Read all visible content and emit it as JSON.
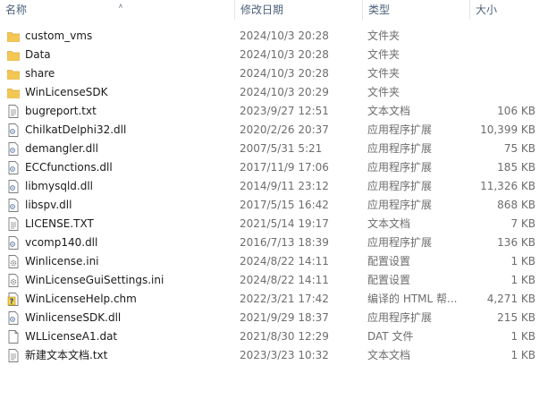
{
  "columns": {
    "name": "名称",
    "date": "修改日期",
    "type": "类型",
    "size": "大小"
  },
  "files": [
    {
      "name": "custom_vms",
      "date": "2024/10/3 20:28",
      "type": "文件夹",
      "size": "",
      "icon": "folder-icon"
    },
    {
      "name": "Data",
      "date": "2024/10/3 20:28",
      "type": "文件夹",
      "size": "",
      "icon": "folder-icon"
    },
    {
      "name": "share",
      "date": "2024/10/3 20:28",
      "type": "文件夹",
      "size": "",
      "icon": "folder-icon"
    },
    {
      "name": "WinLicenseSDK",
      "date": "2024/10/3 20:29",
      "type": "文件夹",
      "size": "",
      "icon": "folder-icon"
    },
    {
      "name": "bugreport.txt",
      "date": "2023/9/27 12:51",
      "type": "文本文档",
      "size": "106 KB",
      "icon": "text-file-icon"
    },
    {
      "name": "ChilkatDelphi32.dll",
      "date": "2020/2/26 20:37",
      "type": "应用程序扩展",
      "size": "10,399 KB",
      "icon": "dll-file-icon"
    },
    {
      "name": "demangler.dll",
      "date": "2007/5/31 5:21",
      "type": "应用程序扩展",
      "size": "75 KB",
      "icon": "dll-file-icon"
    },
    {
      "name": "ECCfunctions.dll",
      "date": "2017/11/9 17:06",
      "type": "应用程序扩展",
      "size": "185 KB",
      "icon": "dll-file-icon"
    },
    {
      "name": "libmysqld.dll",
      "date": "2014/9/11 23:12",
      "type": "应用程序扩展",
      "size": "11,326 KB",
      "icon": "dll-file-icon"
    },
    {
      "name": "libspv.dll",
      "date": "2017/5/15 16:42",
      "type": "应用程序扩展",
      "size": "868 KB",
      "icon": "dll-file-icon"
    },
    {
      "name": "LICENSE.TXT",
      "date": "2021/5/14 19:17",
      "type": "文本文档",
      "size": "7 KB",
      "icon": "text-file-icon"
    },
    {
      "name": "vcomp140.dll",
      "date": "2016/7/13 18:39",
      "type": "应用程序扩展",
      "size": "136 KB",
      "icon": "dll-file-icon"
    },
    {
      "name": "Winlicense.ini",
      "date": "2024/8/22 14:11",
      "type": "配置设置",
      "size": "1 KB",
      "icon": "ini-file-icon"
    },
    {
      "name": "WinLicenseGuiSettings.ini",
      "date": "2024/8/22 14:11",
      "type": "配置设置",
      "size": "1 KB",
      "icon": "ini-file-icon"
    },
    {
      "name": "WinLicenseHelp.chm",
      "date": "2022/3/21 17:42",
      "type": "编译的 HTML 帮...",
      "size": "4,271 KB",
      "icon": "chm-help-icon"
    },
    {
      "name": "WinlicenseSDK.dll",
      "date": "2021/9/29 18:37",
      "type": "应用程序扩展",
      "size": "215 KB",
      "icon": "dll-file-icon"
    },
    {
      "name": "WLLicenseA1.dat",
      "date": "2021/8/30 12:29",
      "type": "DAT 文件",
      "size": "1 KB",
      "icon": "blank-file-icon"
    },
    {
      "name": "新建文本文档.txt",
      "date": "2023/3/23 10:32",
      "type": "文本文档",
      "size": "1 KB",
      "icon": "text-file-icon"
    }
  ],
  "colors": {
    "folder": "#f4c652",
    "folder_dark": "#d9a93a",
    "header_text": "#4c607a",
    "secondary_text": "#6d6d6d"
  }
}
